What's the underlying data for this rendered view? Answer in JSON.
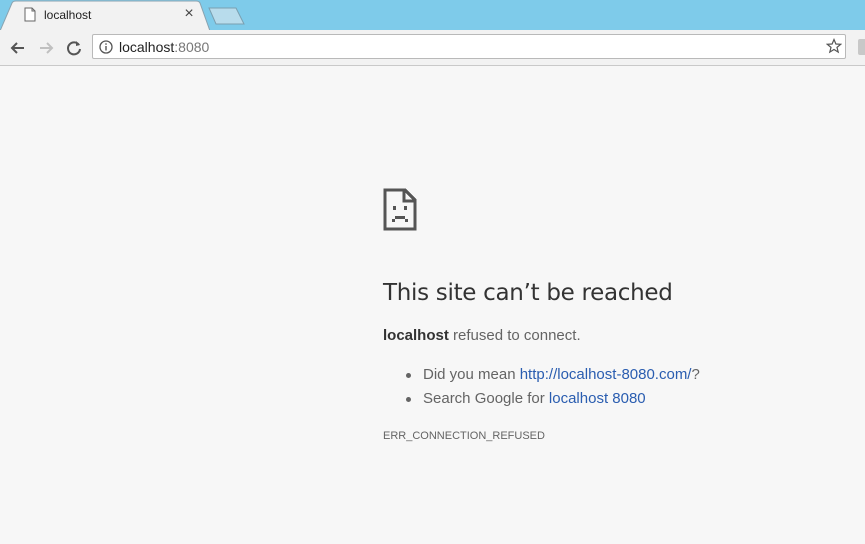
{
  "tab": {
    "title": "localhost",
    "close_glyph": "×",
    "icon": "page-icon"
  },
  "address_bar": {
    "host": "localhost",
    "port": ":8080",
    "info_icon": "info-icon",
    "bookmark_icon": "star-icon"
  },
  "error_page": {
    "icon": "sad-page-icon",
    "heading": "This site can’t be reached",
    "host_bold": "localhost",
    "message_rest": " refused to connect.",
    "suggestion_1_prefix": "Did you mean ",
    "suggestion_1_link": "http://localhost-8080.com/",
    "suggestion_1_suffix": "?",
    "suggestion_2_prefix": "Search Google for ",
    "suggestion_2_link": "localhost 8080",
    "error_code": "ERR_CONNECTION_REFUSED"
  },
  "colors": {
    "titlebar": "#7ecbea",
    "link": "#2a5db0",
    "page_bg": "#f7f7f7"
  }
}
